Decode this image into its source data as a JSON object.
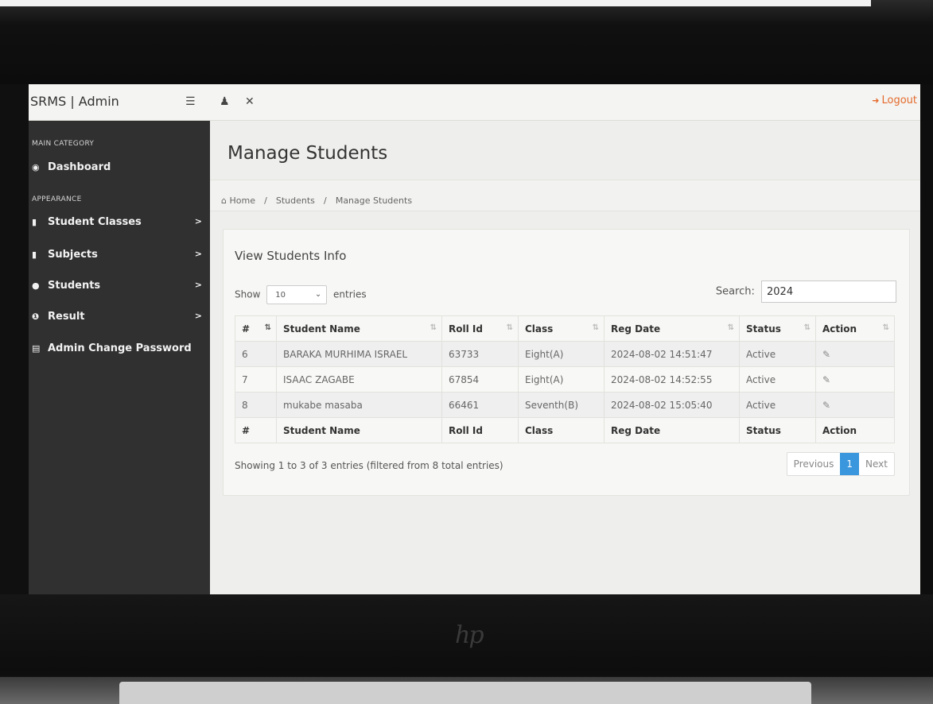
{
  "topbar": {
    "app_title": "SRMS | Admin",
    "logout_label": "Logout",
    "icons": [
      "list-icon",
      "user-icon",
      "expand-icon"
    ]
  },
  "sidebar": {
    "category_main": "MAIN CATEGORY",
    "category_appearance": "APPEARANCE",
    "items": [
      {
        "label": "Dashboard",
        "icon": "dashboard-icon"
      },
      {
        "label": "Student Classes",
        "icon": "file-icon",
        "chevron": ">"
      },
      {
        "label": "Subjects",
        "icon": "file-icon",
        "chevron": ">"
      },
      {
        "label": "Students",
        "icon": "users-icon",
        "chevron": ">"
      },
      {
        "label": "Result",
        "icon": "info-icon",
        "chevron": ">"
      },
      {
        "label": "Admin Change Password",
        "icon": "table-icon"
      }
    ]
  },
  "page": {
    "title": "Manage Students",
    "breadcrumb": [
      "Home",
      "Students",
      "Manage Students"
    ]
  },
  "panel": {
    "title": "View Students Info",
    "show_label": "Show",
    "entries_label": "entries",
    "length_value": "10",
    "search_label": "Search:",
    "search_value": "2024"
  },
  "table": {
    "headers": [
      "#",
      "Student Name",
      "Roll Id",
      "Class",
      "Reg Date",
      "Status",
      "Action"
    ],
    "rows": [
      {
        "num": "6",
        "name": "BARAKA MURHIMA ISRAEL",
        "roll": "63733",
        "class": "Eight(A)",
        "reg": "2024-08-02 14:51:47",
        "status": "Active"
      },
      {
        "num": "7",
        "name": "ISAAC ZAGABE",
        "roll": "67854",
        "class": "Eight(A)",
        "reg": "2024-08-02 14:52:55",
        "status": "Active"
      },
      {
        "num": "8",
        "name": "mukabe masaba",
        "roll": "66461",
        "class": "Seventh(B)",
        "reg": "2024-08-02 15:05:40",
        "status": "Active"
      }
    ]
  },
  "footer": {
    "info": "Showing 1 to 3 of 3 entries (filtered from 8 total entries)",
    "prev": "Previous",
    "page": "1",
    "next": "Next"
  },
  "colors": {
    "sidebar_bg": "#303030",
    "logout": "#e46a2c",
    "pager_active": "#3a97dd"
  }
}
